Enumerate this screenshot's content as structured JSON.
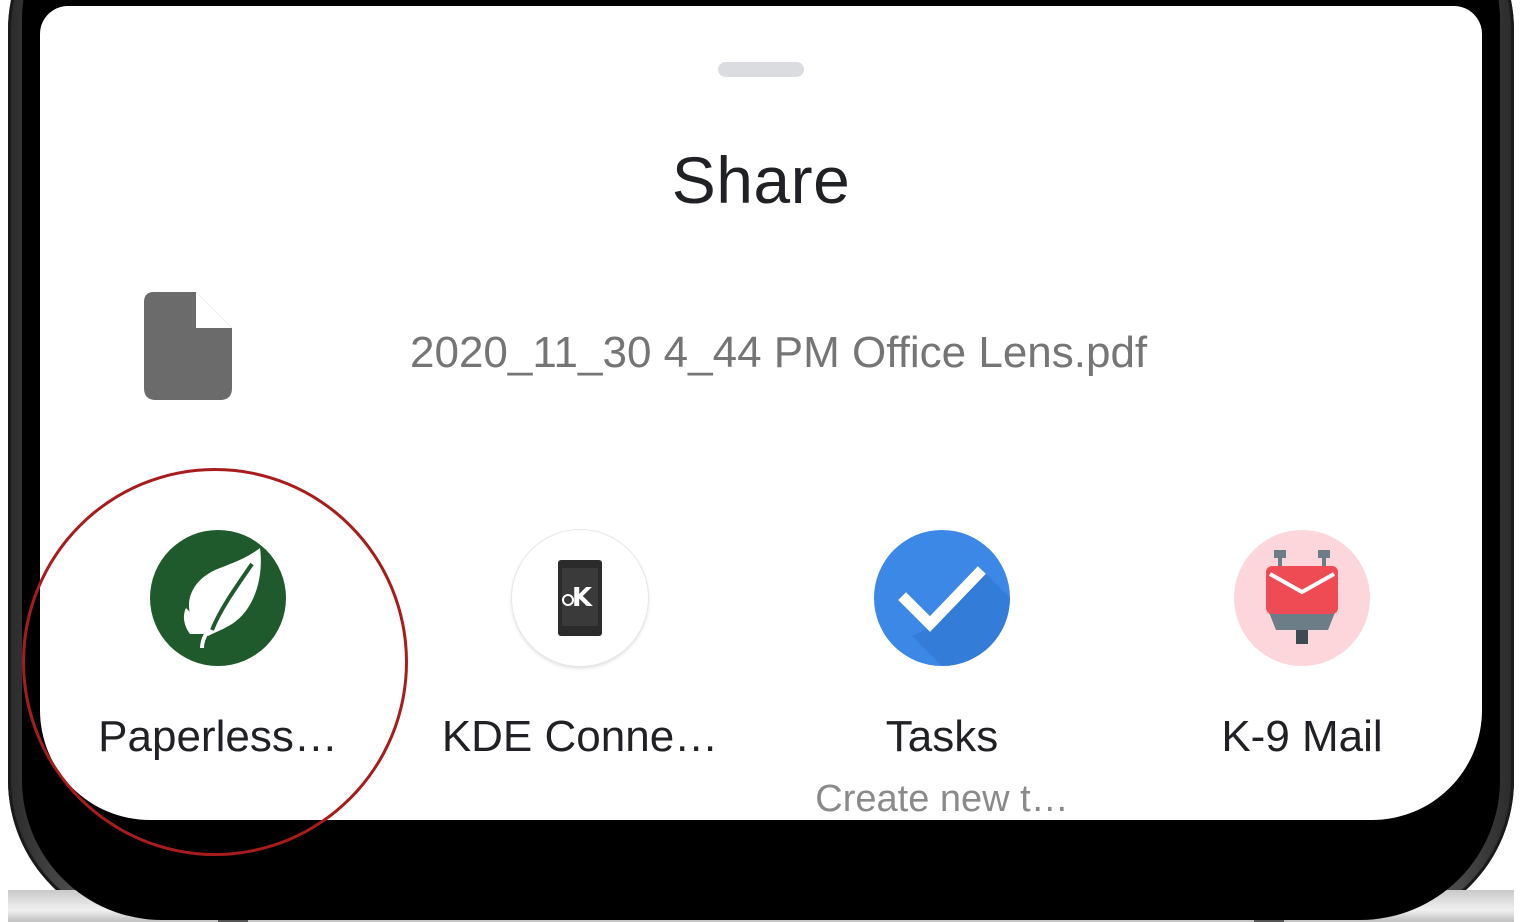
{
  "share_sheet": {
    "title": "Share",
    "file": {
      "icon": "file-icon",
      "name": "2020_11_30 4_44 PM Office Lens.pdf"
    },
    "targets": [
      {
        "label": "Paperless…",
        "icon": "paperless-leaf-icon",
        "color": "#1e5a2b",
        "highlighted": true
      },
      {
        "label": "KDE Conne…",
        "icon": "kde-connect-icon",
        "color": "#ffffff"
      },
      {
        "label": "Tasks",
        "sublabel": "Create new t…",
        "icon": "tasks-check-icon",
        "color": "#3b88e6"
      },
      {
        "label": "K-9 Mail",
        "icon": "k9-mail-icon",
        "color": "#fcd6da"
      }
    ]
  },
  "colors": {
    "highlight_ring": "#a81c1c",
    "title_text": "#202124",
    "file_text": "#757575"
  }
}
